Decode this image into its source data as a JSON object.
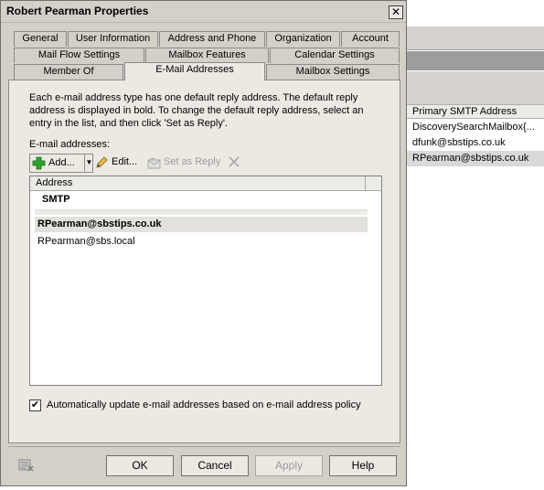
{
  "dialog": {
    "title": "Robert Pearman Properties",
    "close_label": "✕"
  },
  "tabs": {
    "row1": [
      "General",
      "User Information",
      "Address and Phone",
      "Organization",
      "Account"
    ],
    "row2": [
      "Mail Flow Settings",
      "Mailbox Features",
      "Calendar Settings"
    ],
    "row3": [
      "Member Of",
      "E-Mail Addresses",
      "Mailbox Settings"
    ],
    "active": "E-Mail Addresses"
  },
  "email_tab": {
    "description": "Each e-mail address type has one default reply address. The default reply address is displayed in bold. To change the default reply address, select an entry in the list, and then click 'Set as Reply'.",
    "addresses_label": "E-mail addresses:",
    "toolbar": {
      "add_label": "Add...",
      "edit_label": "Edit...",
      "set_reply_label": "Set as Reply"
    },
    "list": {
      "column_header": "Address",
      "group": "SMTP",
      "entries": [
        {
          "address": "RPearman@sbstips.co.uk",
          "is_default": true
        },
        {
          "address": "RPearman@sbs.local",
          "is_default": false
        }
      ]
    },
    "auto_update": {
      "label": "Automatically update e-mail addresses based on e-mail address policy",
      "checked": true
    }
  },
  "buttons": {
    "ok": "OK",
    "cancel": "Cancel",
    "apply": "Apply",
    "help": "Help"
  },
  "background_list": {
    "column_header": "Primary SMTP Address",
    "rows": [
      {
        "value": "DiscoverySearchMailbox{...",
        "selected": false
      },
      {
        "value": "dfunk@sbstips.co.uk",
        "selected": false
      },
      {
        "value": "RPearman@sbstips.co.uk",
        "selected": true
      }
    ]
  },
  "icons": {
    "add": "plus-icon",
    "edit": "pencil-icon",
    "set_reply": "reply-icon",
    "delete": "x-icon",
    "help_corner": "help-icon"
  },
  "colors": {
    "dialog_bg": "#d4d0c8",
    "panel_bg": "#ece9e2",
    "add_green": "#2fa12f",
    "selected_row": "#d9d9d9"
  }
}
